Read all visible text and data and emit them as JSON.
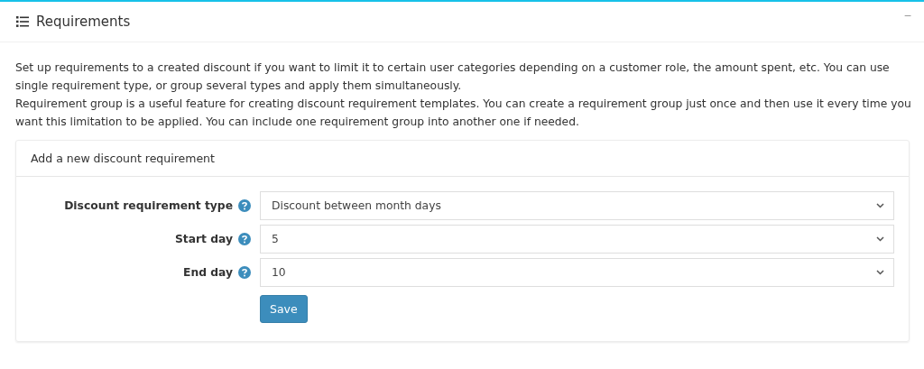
{
  "panel": {
    "title": "Requirements",
    "collapse_icon": "−"
  },
  "description": [
    "Set up requirements to a created discount if you want to limit it to certain user categories depending on a customer role, the amount spent, etc. You can use single requirement type, or group several types and apply them simultaneously.",
    "Requirement group is a useful feature for creating discount requirement templates. You can create a requirement group just once and then use it every time you want this limitation to be applied. You can include one requirement group into another one if needed."
  ],
  "form": {
    "title": "Add a new discount requirement",
    "fields": [
      {
        "label": "Discount requirement type",
        "value": "Discount between month days"
      },
      {
        "label": "Start day",
        "value": "5"
      },
      {
        "label": "End day",
        "value": "10"
      }
    ],
    "save_button": "Save"
  }
}
